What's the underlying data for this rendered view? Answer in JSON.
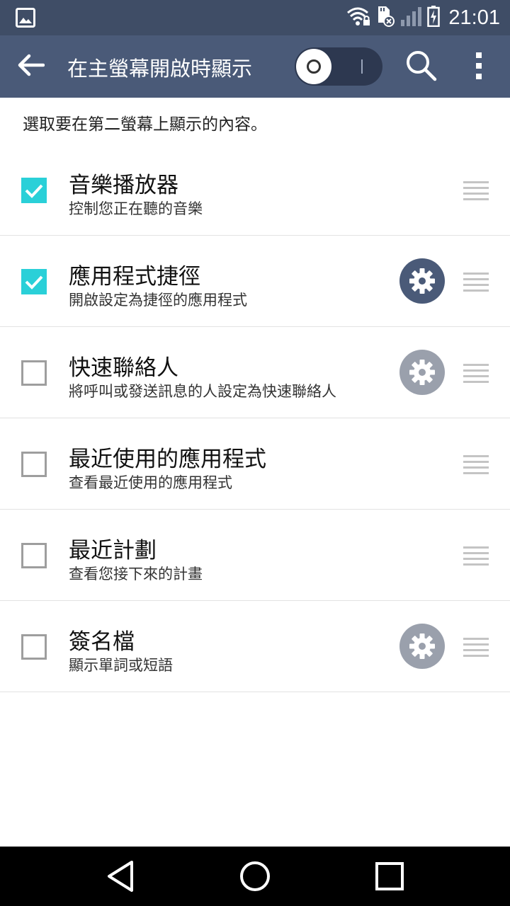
{
  "status_bar": {
    "time": "21:01",
    "icons": [
      "image-notification-icon",
      "wifi-lock-icon",
      "sd-card-error-icon",
      "signal-icon",
      "battery-charging-icon"
    ]
  },
  "app_bar": {
    "title": "在主螢幕開啟時顯示",
    "toggle_on": false,
    "icons": [
      "back-arrow-icon",
      "search-icon",
      "more-vert-icon"
    ]
  },
  "instruction": "選取要在第二螢幕上顯示的內容。",
  "items": [
    {
      "title": "音樂播放器",
      "subtitle": "控制您正在聽的音樂",
      "checked": true,
      "settings": "none"
    },
    {
      "title": "應用程式捷徑",
      "subtitle": "開啟設定為捷徑的應用程式",
      "checked": true,
      "settings": "active"
    },
    {
      "title": "快速聯絡人",
      "subtitle": "將呼叫或發送訊息的人設定為快速聯絡人",
      "checked": false,
      "settings": "inactive"
    },
    {
      "title": "最近使用的應用程式",
      "subtitle": "查看最近使用的應用程式",
      "checked": false,
      "settings": "none"
    },
    {
      "title": "最近計劃",
      "subtitle": "查看您接下來的計畫",
      "checked": false,
      "settings": "none"
    },
    {
      "title": "簽名檔",
      "subtitle": "顯示單詞或短語",
      "checked": false,
      "settings": "inactive"
    }
  ],
  "colors": {
    "status_bar": "#3f4d66",
    "app_bar": "#4a5a78",
    "checkbox_checked": "#2ad0d8",
    "gear_active": "#4a5a78",
    "gear_inactive": "#9aa0ac"
  },
  "nav_bar": {
    "icons": [
      "back-triangle-icon",
      "home-circle-icon",
      "recents-square-icon"
    ]
  }
}
